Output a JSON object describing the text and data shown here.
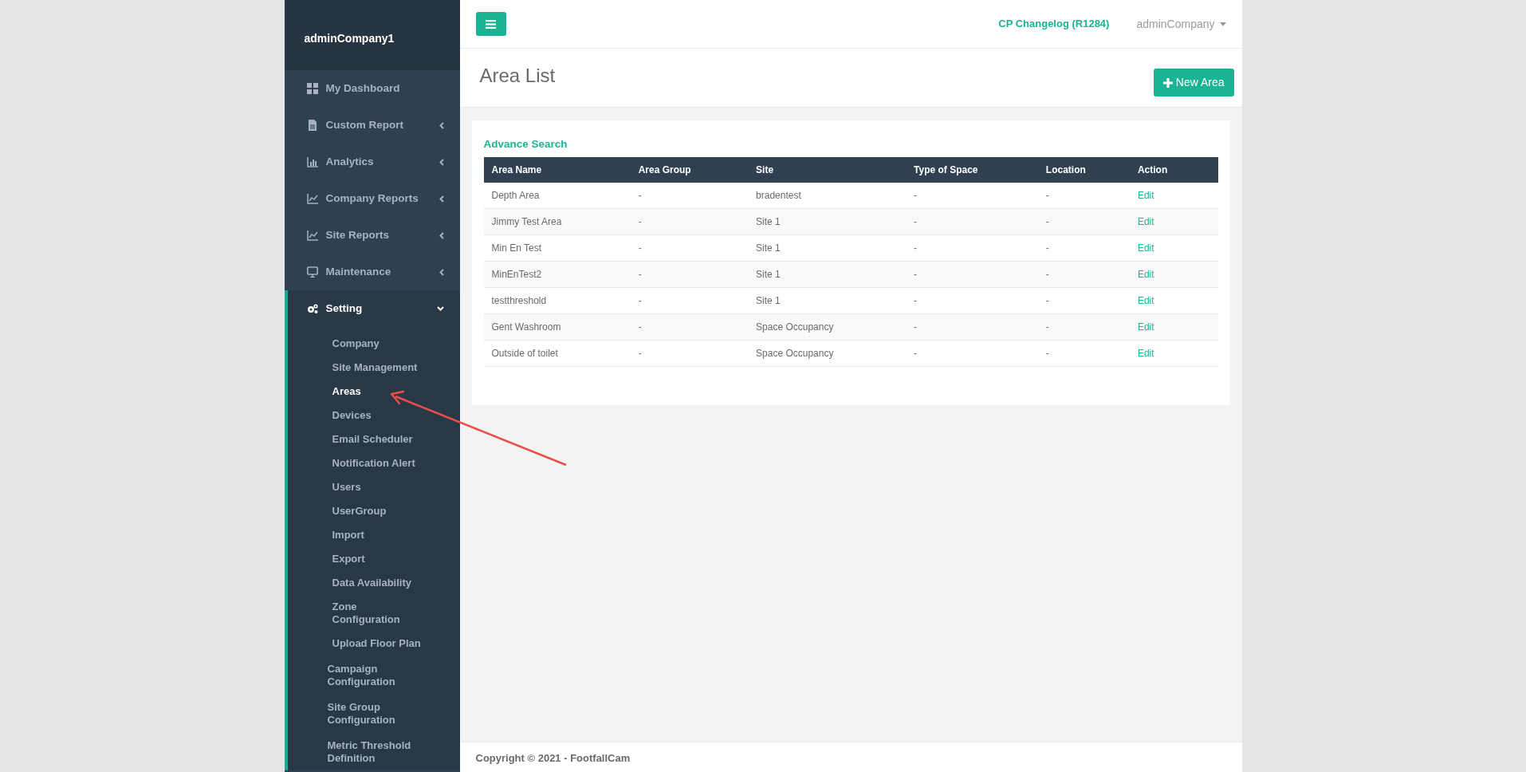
{
  "sidebar": {
    "brand": "adminCompany1",
    "items": [
      {
        "label": "My Dashboard",
        "kind": "link",
        "expanded": false
      },
      {
        "label": "Custom Report",
        "kind": "menu",
        "expanded": false
      },
      {
        "label": "Analytics",
        "kind": "menu",
        "expanded": false
      },
      {
        "label": "Company Reports",
        "kind": "menu",
        "expanded": false
      },
      {
        "label": "Site Reports",
        "kind": "menu",
        "expanded": false
      },
      {
        "label": "Maintenance",
        "kind": "menu",
        "expanded": false
      },
      {
        "label": "Setting",
        "kind": "menu",
        "expanded": true,
        "children": [
          {
            "label": "Company",
            "selected": false
          },
          {
            "label": "Site Management",
            "selected": false
          },
          {
            "label": "Areas",
            "selected": true
          },
          {
            "label": "Devices",
            "selected": false
          },
          {
            "label": "Email Scheduler",
            "selected": false
          },
          {
            "label": "Notification Alert",
            "selected": false
          },
          {
            "label": "Users",
            "selected": false
          },
          {
            "label": "UserGroup",
            "selected": false
          },
          {
            "label": "Import",
            "selected": false
          },
          {
            "label": "Export",
            "selected": false
          },
          {
            "label": "Data Availability",
            "selected": false
          },
          {
            "label": "Zone Configuration",
            "selected": false
          },
          {
            "label": "Upload Floor Plan",
            "selected": false
          },
          {
            "label": "Campaign Configuration",
            "selected": false
          },
          {
            "label": "Site Group Configuration",
            "selected": false
          },
          {
            "label": "Metric Threshold Definition",
            "selected": false
          }
        ]
      }
    ]
  },
  "topbar": {
    "changelog": "CP Changelog (R1284)",
    "user": "adminCompany"
  },
  "page": {
    "title": "Area List",
    "new_button": "New Area"
  },
  "card": {
    "search_link": "Advance Search",
    "table": {
      "columns": [
        "Area Name",
        "Area Group",
        "Site",
        "Type of Space",
        "Location",
        "Action"
      ],
      "rows": [
        [
          "Depth Area",
          "-",
          "bradentest",
          "-",
          "-",
          "Edit"
        ],
        [
          "Jimmy Test Area",
          "-",
          "Site 1",
          "-",
          "-",
          "Edit"
        ],
        [
          "Min En Test",
          "-",
          "Site 1",
          "-",
          "-",
          "Edit"
        ],
        [
          "MinEnTest2",
          "-",
          "Site 1",
          "-",
          "-",
          "Edit"
        ],
        [
          "testthreshold",
          "-",
          "Site 1",
          "-",
          "-",
          "Edit"
        ],
        [
          "Gent Washroom",
          "-",
          "Space Occupancy",
          "-",
          "-",
          "Edit"
        ],
        [
          "Outside of toilet",
          "-",
          "Space Occupancy",
          "-",
          "-",
          "Edit"
        ]
      ]
    }
  },
  "footer": "Copyright © 2021 - FootfallCam"
}
